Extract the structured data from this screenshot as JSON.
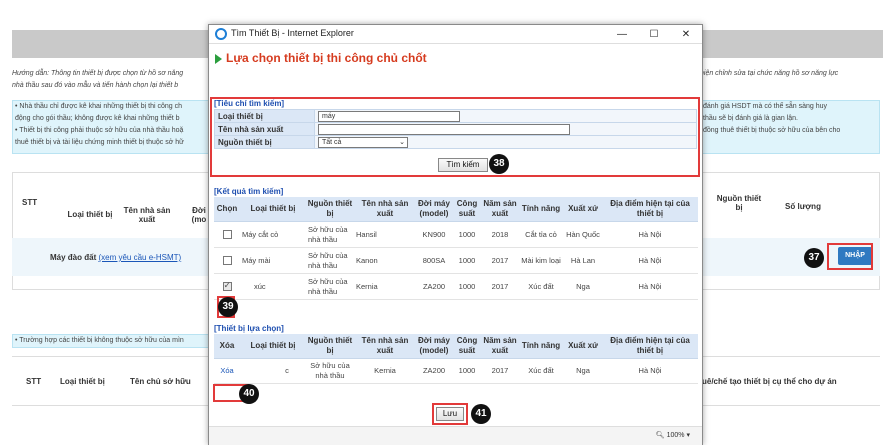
{
  "background": {
    "hint_left": "Hướng dẫn: Thông tin thiết bị được chọn từ hồ sơ năng",
    "hint_left_2": "nhà thầu sau đó vào mẫu và tiến hành chọn lại thiết b",
    "hint_right": "hiện chỉnh sửa tại chức năng hồ sơ năng lực",
    "info_lines_left": [
      "• Nhà thầu chỉ được kê khai những thiết bị thi công ch",
      "động cho gói thầu; không được kê khai những thiết b",
      "• Thiết bị thi công phải thuộc sở hữu của nhà thầu hoặ",
      "thuê thiết bị và tài liệu chứng minh thiết bị thuộc sở hữ"
    ],
    "info_lines_right": [
      "đánh giá HSDT mà có thể sẵn sàng huy",
      "thầu sẽ bị đánh giá là gian lận.",
      "đồng thuê thiết bị thuộc sở hữu của bên cho",
      ""
    ],
    "table_headers": {
      "stt": "STT",
      "loai_thiet_bi": "Loại thiết bị",
      "ten_nha_san_xuat": "Tên nhà sản xuất",
      "doi": "Đời (mo",
      "nguon_thiet_bi": "Nguồn thiết bị",
      "so_luong": "Số lượng"
    },
    "row_label": "Máy đào đất",
    "row_link": "(xem yêu cầu e-HSMT)",
    "nhap_label": "NHẬP",
    "note": "• Trường hợp các thiết bị không thuộc sở hữu của mìn",
    "table2_headers": {
      "stt": "STT",
      "loai_thiet_bi": "Loại thiết bị",
      "ten_chu_so_huu": "Tên chủ sở hữu",
      "right": "uê/chế tạo thiết bị cụ thể cho dự án"
    }
  },
  "callouts": [
    "37",
    "38",
    "39",
    "40",
    "41"
  ],
  "window": {
    "title": "Tìm Thiết Bị - Internet Explorer",
    "minimize": "—",
    "maximize": "☐",
    "close": "✕",
    "header": "Lựa chọn thiết bị thi công chủ chốt",
    "zoom": "100%"
  },
  "criteria": {
    "title": "[Tiêu chí tìm kiếm]",
    "fields": {
      "loai_thiet_bi": {
        "label": "Loại thiết bị",
        "value": "máy"
      },
      "ten_nha_san_xuat": {
        "label": "Tên nhà sản xuất",
        "value": ""
      },
      "nguon_thiet_bi": {
        "label": "Nguồn thiết bị",
        "value": "Tất cả"
      }
    },
    "search_label": "Tìm kiếm"
  },
  "results": {
    "title": "[Kết quả tìm kiếm]",
    "headers": [
      "Chọn",
      "Loại thiết bị",
      "Nguồn thiết bị",
      "Tên nhà sản xuất",
      "Đời máy (model)",
      "Công suất",
      "Năm sản xuất",
      "Tính năng",
      "Xuất xứ",
      "Địa điểm hiện tại của thiết bị"
    ],
    "rows": [
      {
        "checked": false,
        "loai": "Máy cắt cỏ",
        "nguon": "Sở hữu của nhà thầu",
        "nsx": "Hansil",
        "model": "KN900",
        "congsuat": "1000",
        "nam": "2018",
        "tinhnang": "Cắt tỉa cỏ",
        "xuatxu": "Hàn Quốc",
        "diadiem": "Hà Nội"
      },
      {
        "checked": false,
        "loai": "Máy mài",
        "nguon": "Sở hữu của nhà thầu",
        "nsx": "Kanon",
        "model": "800SA",
        "congsuat": "1000",
        "nam": "2017",
        "tinhnang": "Mài kim loại",
        "xuatxu": "Hà Lan",
        "diadiem": "Hà Nội"
      },
      {
        "checked": true,
        "loai": "xúc",
        "nguon": "Sở hữu của nhà thầu",
        "nsx": "Kernia",
        "model": "ZA200",
        "congsuat": "1000",
        "nam": "2017",
        "tinhnang": "Xúc đất",
        "xuatxu": "Nga",
        "diadiem": "Hà Nội"
      }
    ]
  },
  "selected": {
    "title": "[Thiết bị lựa chọn]",
    "headers": [
      "Xóa",
      "Loại thiết bị",
      "Nguồn thiết bị",
      "Tên nhà sản xuất",
      "Đời máy (model)",
      "Công suất",
      "Năm sản xuất",
      "Tính năng",
      "Xuất xứ",
      "Địa điểm hiện tại của thiết bị"
    ],
    "rows": [
      {
        "xoa": "Xóa",
        "loai": "c",
        "nguon": "Sở hữu của nhà thầu",
        "nsx": "Kernia",
        "model": "ZA200",
        "congsuat": "1000",
        "nam": "2017",
        "tinhnang": "Xúc đất",
        "xuatxu": "Nga",
        "diadiem": "Hà Nội"
      }
    ],
    "save_label": "Lưu"
  }
}
